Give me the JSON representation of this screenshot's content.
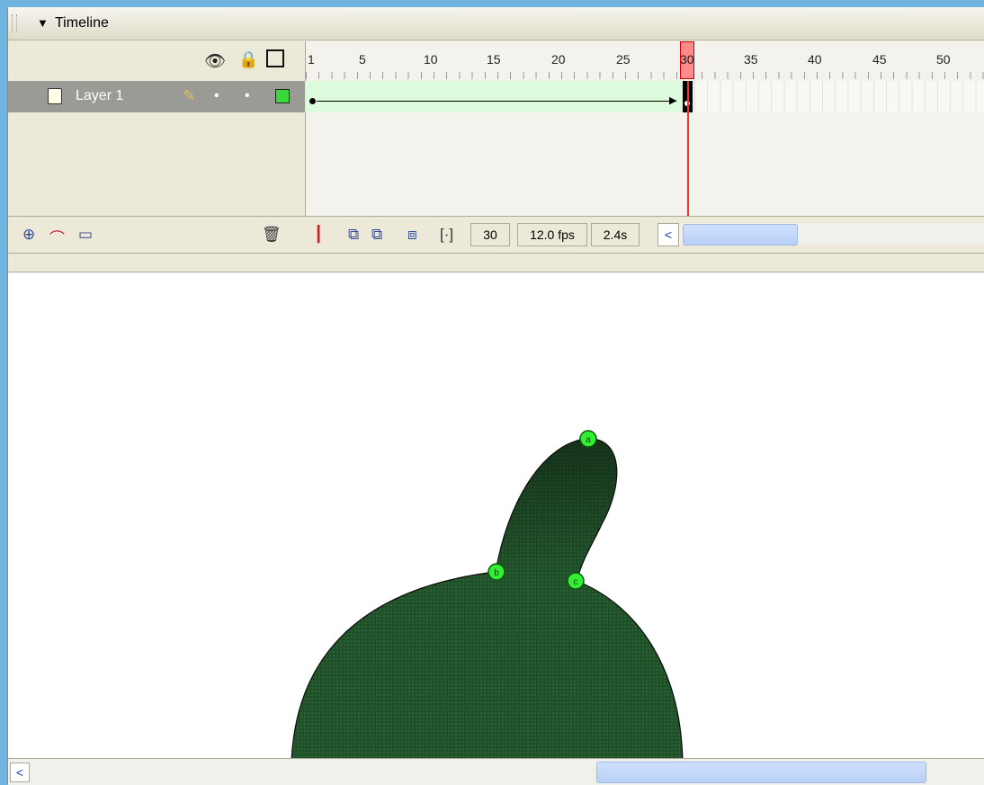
{
  "panel": {
    "collapse_glyph": "▼",
    "title": "Timeline"
  },
  "header_icons": {
    "eye": "eye-icon",
    "lock": "lock-icon",
    "outline": "outline-icon"
  },
  "ruler": {
    "labels": [
      "1",
      "5",
      "10",
      "15",
      "20",
      "25",
      "30",
      "35",
      "40",
      "45",
      "50"
    ],
    "current_frame": "30"
  },
  "layer": {
    "name": "Layer 1",
    "color": "#38d838"
  },
  "toolbar": {
    "current_frame": "30",
    "fps": "12.0 fps",
    "elapsed": "2.4s",
    "scroll_left": "<"
  },
  "stage": {
    "points": [
      "a",
      "b",
      "c"
    ],
    "point_color": "#33ee33",
    "shape_color": "#1d4d24"
  },
  "bottom_scroll": {
    "left": "<"
  }
}
